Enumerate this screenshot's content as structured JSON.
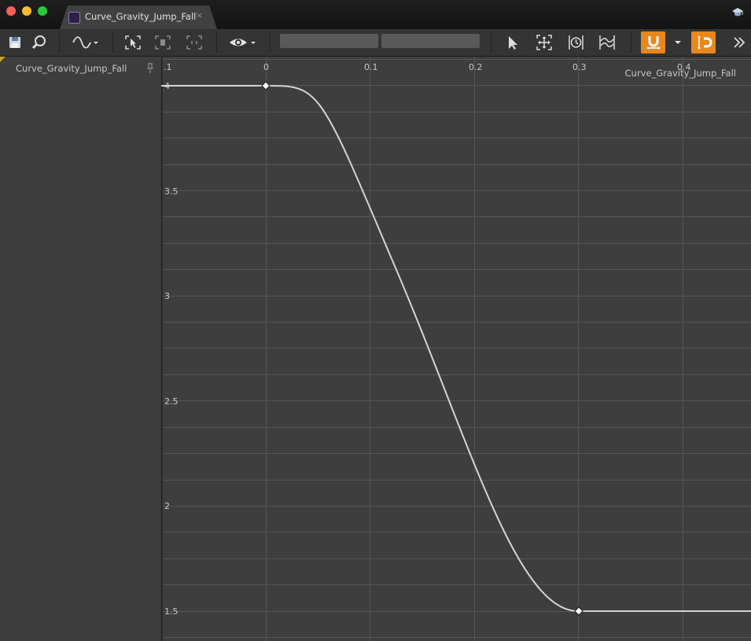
{
  "window": {
    "tab_title": "Curve_Gravity_Jump_Fall",
    "tab_close": "×"
  },
  "icons": [
    "save-icon",
    "browse-icon",
    "curve-mode-icon",
    "frame-all-icon",
    "frame-selected-icon",
    "frame-horizontal-icon",
    "view-options-icon",
    "select-tool-icon",
    "transform-tool-icon",
    "retime-tool-icon",
    "multi-curve-tool-icon",
    "snap-magnet-icon",
    "snap-value-icon",
    "more-icon",
    "pin-icon",
    "help-icon"
  ],
  "colors": {
    "accent": "#e7881f",
    "panel": "#3e3e3e",
    "toolbar": "#343434",
    "curve": "#d4d4d4"
  },
  "curve_list": {
    "items": [
      {
        "label": "Curve_Gravity_Jump_Fall"
      }
    ]
  },
  "graph": {
    "curve_label": "Curve_Gravity_Jump_Fall",
    "x_ticks": [
      ".1",
      "0",
      "0.1",
      "0.2",
      "0.3",
      "0.4"
    ],
    "y_ticks": [
      "4",
      "3.5",
      "3",
      "2.5",
      "2",
      "1.5"
    ],
    "keys": [
      {
        "time": 0,
        "value": 4
      },
      {
        "time": 0.3,
        "value": 1.5
      }
    ]
  }
}
